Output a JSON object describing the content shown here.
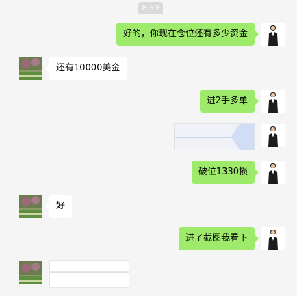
{
  "timestamp": "8:59",
  "messages": [
    {
      "side": "right",
      "type": "text",
      "text": "好的，你现在仓位还有多少资金"
    },
    {
      "side": "left",
      "type": "text",
      "text": "还有10000美金"
    },
    {
      "side": "right",
      "type": "text",
      "text": "进2手多单"
    },
    {
      "side": "right",
      "type": "image"
    },
    {
      "side": "right",
      "type": "text",
      "text": "破位1330损"
    },
    {
      "side": "left",
      "type": "text",
      "text": "好"
    },
    {
      "side": "right",
      "type": "text",
      "text": "进了截图我看下"
    },
    {
      "side": "left",
      "type": "image"
    }
  ]
}
